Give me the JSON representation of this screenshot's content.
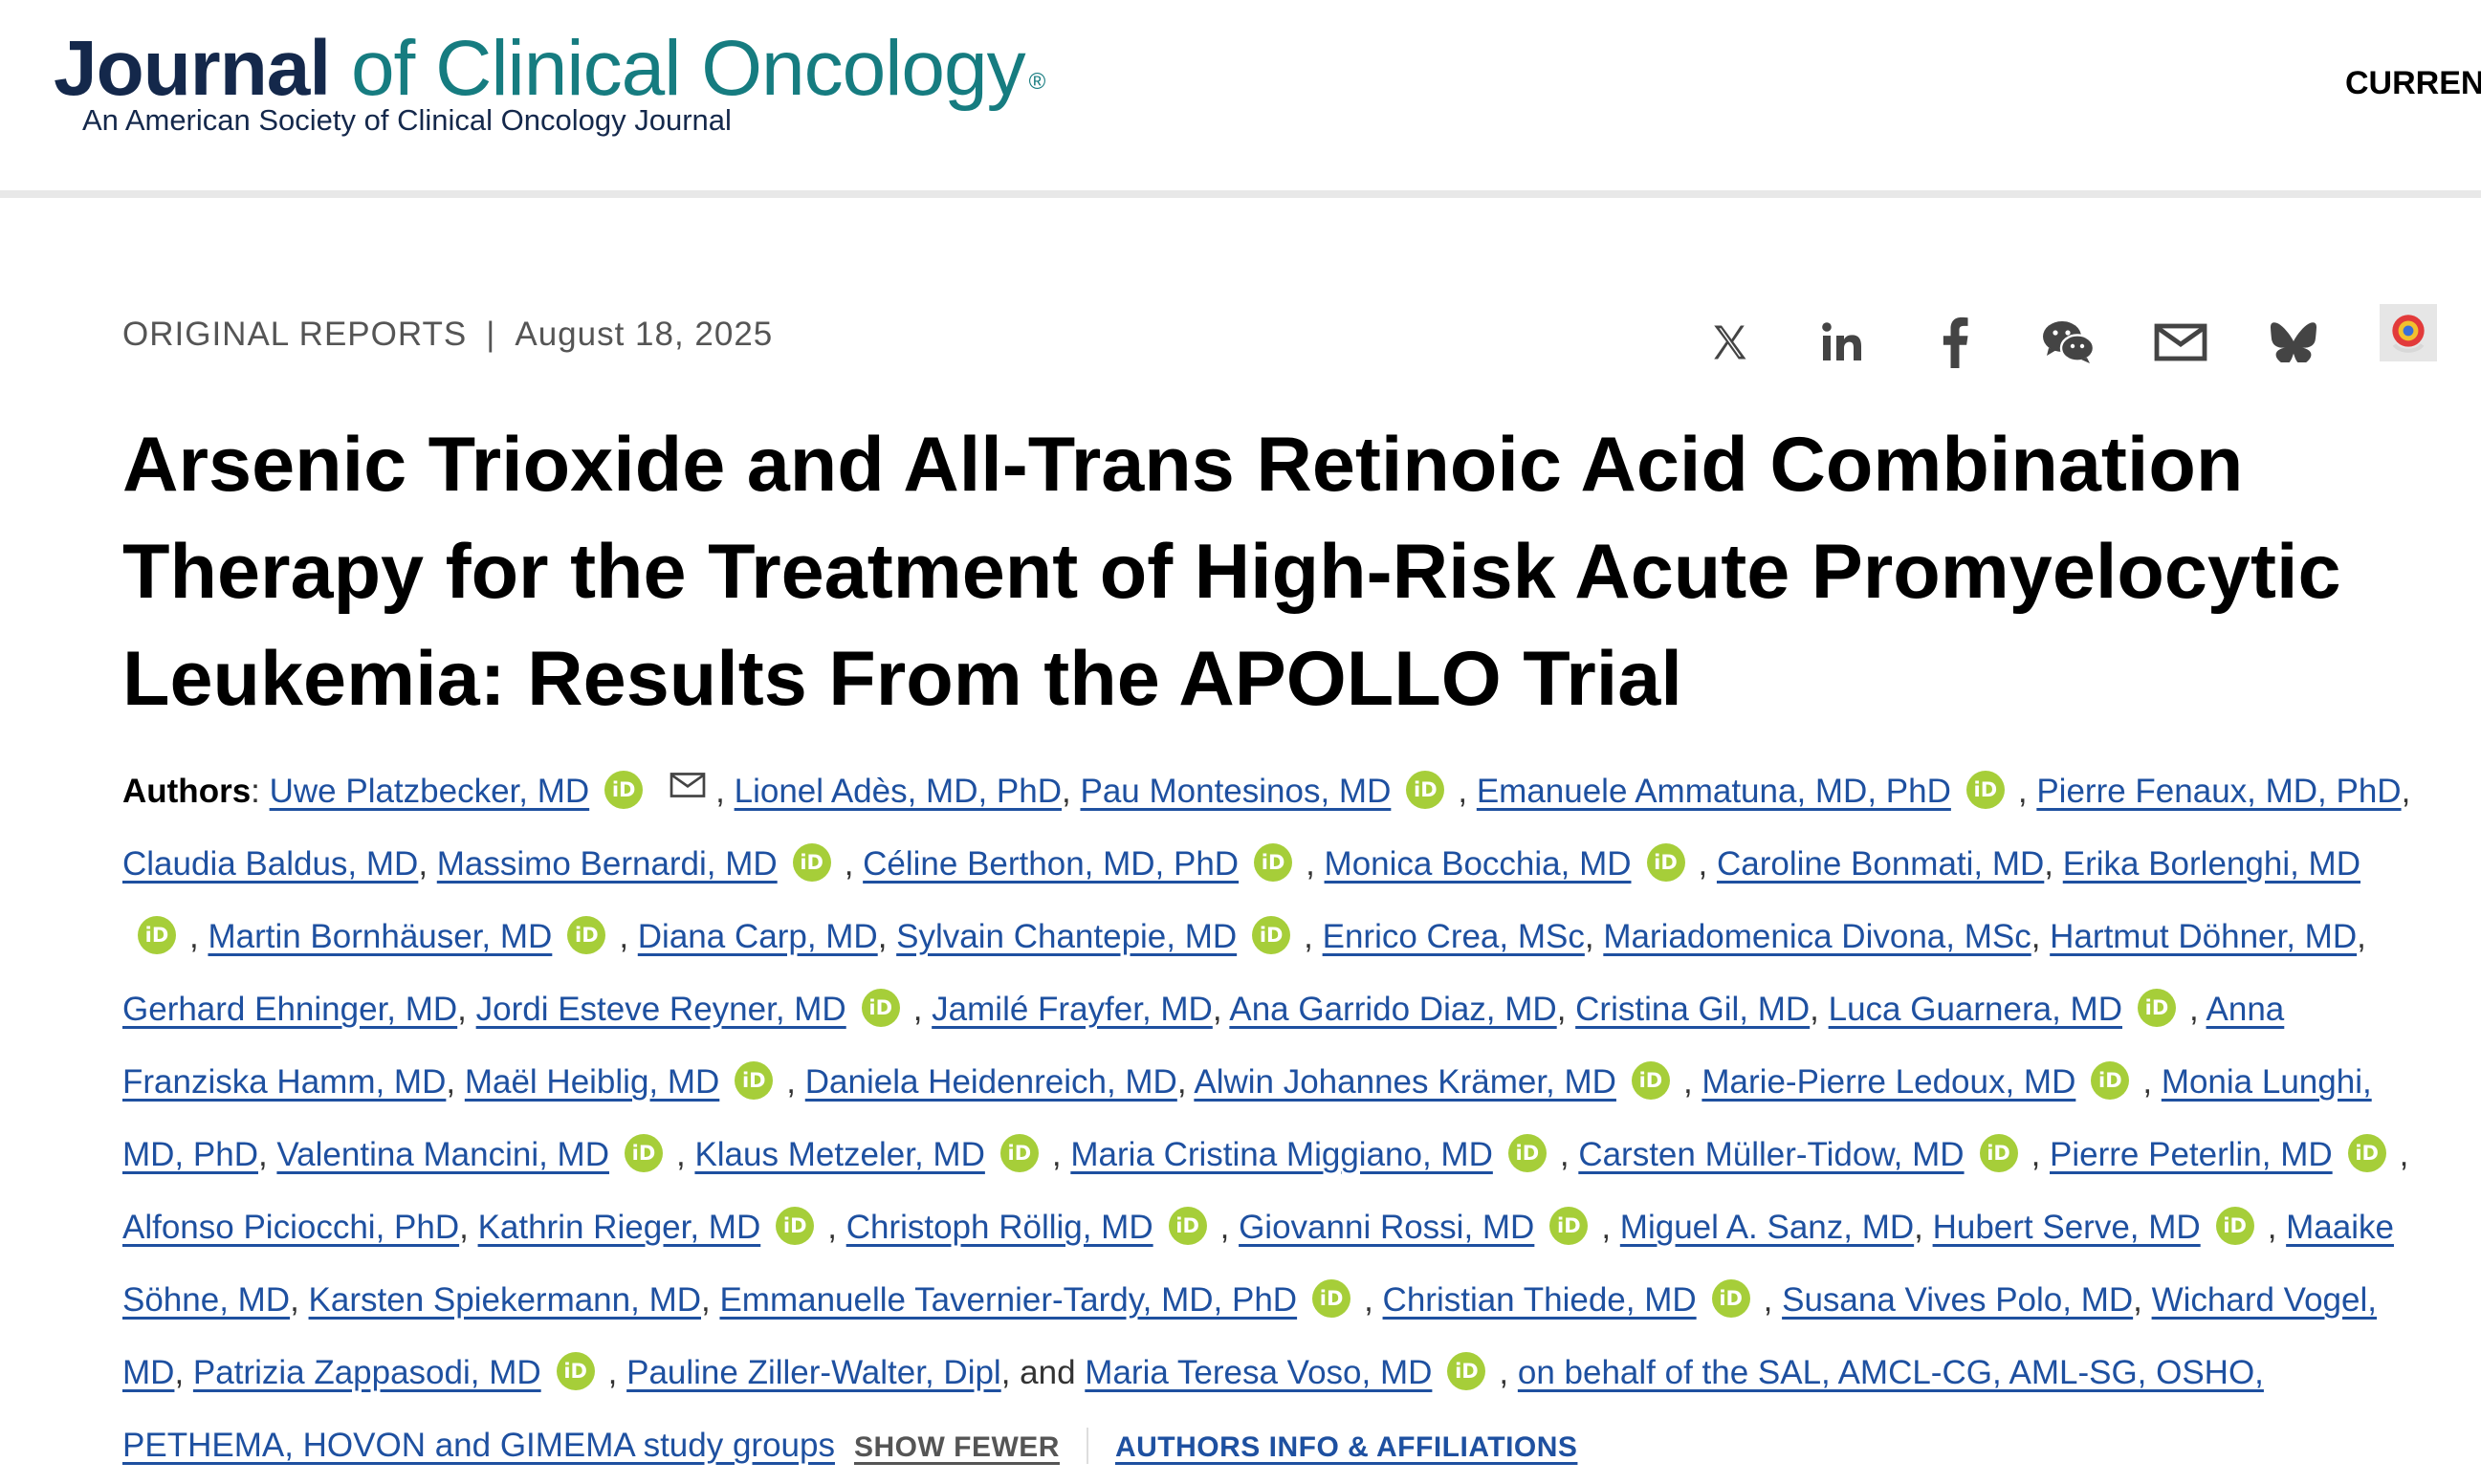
{
  "header": {
    "logo_journal": "Journal",
    "logo_rest": " of Clinical Oncology",
    "logo_reg": "®",
    "logo_sub": "An American Society of Clinical Oncology Journal",
    "nav_current": "CURREN",
    "brand_colors": {
      "navy": "#14284b",
      "teal": "#167c80"
    }
  },
  "article": {
    "section": "ORIGINAL REPORTS",
    "separator": "|",
    "date": "August 18, 2025",
    "title": "Arsenic Trioxide and All-Trans Retinoic Acid Combination Therapy for the Treatment of High-Risk Acute Promyelocytic Leukemia: Results From the APOLLO Trial"
  },
  "share": {
    "icons": [
      "x-icon",
      "linkedin-icon",
      "facebook-icon",
      "wechat-icon",
      "email-icon",
      "bluesky-icon",
      "mendeley-icon"
    ]
  },
  "authors": {
    "label": "Authors",
    "colon": ": ",
    "list": [
      {
        "name": "Uwe Platzbecker, MD",
        "orcid": true,
        "email": true,
        "sep": ", "
      },
      {
        "name": "Lionel Adès, MD, PhD",
        "orcid": false,
        "sep": ", "
      },
      {
        "name": "Pau Montesinos, MD",
        "orcid": true,
        "sep": ", "
      },
      {
        "name": "Emanuele Ammatuna, MD, PhD",
        "orcid": true,
        "sep": ", "
      },
      {
        "name": "Pierre Fenaux, MD, PhD",
        "orcid": false,
        "sep": ", "
      },
      {
        "name": "Claudia Baldus, MD",
        "orcid": false,
        "sep": ", "
      },
      {
        "name": "Massimo Bernardi, MD",
        "orcid": true,
        "sep": ", "
      },
      {
        "name": "Céline Berthon, MD, PhD",
        "orcid": true,
        "sep": ", "
      },
      {
        "name": "Monica Bocchia, MD",
        "orcid": true,
        "sep": ", "
      },
      {
        "name": "Caroline Bonmati, MD",
        "orcid": false,
        "sep": ", "
      },
      {
        "name": "Erika Borlenghi, MD",
        "orcid": true,
        "sep": ", "
      },
      {
        "name": "Martin Bornhäuser, MD",
        "orcid": true,
        "sep": ", "
      },
      {
        "name": "Diana Carp, MD",
        "orcid": false,
        "sep": ", "
      },
      {
        "name": "Sylvain Chantepie, MD",
        "orcid": true,
        "sep": ", "
      },
      {
        "name": "Enrico Crea, MSc",
        "orcid": false,
        "sep": ", "
      },
      {
        "name": "Mariadomenica Divona, MSc",
        "orcid": false,
        "sep": ", "
      },
      {
        "name": "Hartmut Döhner, MD",
        "orcid": false,
        "sep": ", "
      },
      {
        "name": "Gerhard Ehninger, MD",
        "orcid": false,
        "sep": ", "
      },
      {
        "name": "Jordi Esteve Reyner, MD",
        "orcid": true,
        "sep": ", "
      },
      {
        "name": "Jamilé Frayfer, MD",
        "orcid": false,
        "sep": ", "
      },
      {
        "name": "Ana Garrido Diaz, MD",
        "orcid": false,
        "sep": ", "
      },
      {
        "name": "Cristina Gil, MD",
        "orcid": false,
        "sep": ", "
      },
      {
        "name": "Luca Guarnera, MD",
        "orcid": true,
        "sep": ", "
      },
      {
        "name": "Anna Franziska Hamm, MD",
        "orcid": false,
        "sep": ", "
      },
      {
        "name": "Maël Heiblig, MD",
        "orcid": true,
        "sep": ", "
      },
      {
        "name": "Daniela Heidenreich, MD",
        "orcid": false,
        "sep": ", "
      },
      {
        "name": "Alwin Johannes Krämer, MD",
        "orcid": true,
        "sep": ", "
      },
      {
        "name": "Marie-Pierre Ledoux, MD",
        "orcid": true,
        "sep": ", "
      },
      {
        "name": "Monia Lunghi, MD, PhD",
        "orcid": false,
        "sep": ", "
      },
      {
        "name": "Valentina Mancini, MD",
        "orcid": true,
        "sep": ", "
      },
      {
        "name": "Klaus Metzeler, MD",
        "orcid": true,
        "sep": ", "
      },
      {
        "name": "Maria Cristina Miggiano, MD",
        "orcid": true,
        "sep": ", "
      },
      {
        "name": "Carsten Müller-Tidow, MD",
        "orcid": true,
        "sep": ", "
      },
      {
        "name": "Pierre Peterlin, MD",
        "orcid": true,
        "sep": ", "
      },
      {
        "name": "Alfonso Piciocchi, PhD",
        "orcid": false,
        "sep": ", "
      },
      {
        "name": "Kathrin Rieger, MD",
        "orcid": true,
        "sep": ", "
      },
      {
        "name": "Christoph Röllig, MD",
        "orcid": true,
        "sep": ", "
      },
      {
        "name": "Giovanni Rossi, MD",
        "orcid": true,
        "sep": ", "
      },
      {
        "name": "Miguel A. Sanz, MD",
        "orcid": false,
        "sep": ", "
      },
      {
        "name": "Hubert Serve, MD",
        "orcid": true,
        "sep": ", "
      },
      {
        "name": "Maaike Söhne, MD",
        "orcid": false,
        "sep": ", "
      },
      {
        "name": "Karsten Spiekermann, MD",
        "orcid": false,
        "sep": ", "
      },
      {
        "name": "Emmanuelle Tavernier-Tardy, MD, PhD",
        "orcid": true,
        "sep": ", "
      },
      {
        "name": "Christian Thiede, MD",
        "orcid": true,
        "sep": ", "
      },
      {
        "name": "Susana Vives Polo, MD",
        "orcid": false,
        "sep": ", "
      },
      {
        "name": "Wichard Vogel, MD",
        "orcid": false,
        "sep": ", "
      },
      {
        "name": "Patrizia Zappasodi, MD",
        "orcid": true,
        "sep": ", "
      },
      {
        "name": "Pauline Ziller-Walter, Dipl",
        "orcid": false,
        "sep": ", and "
      },
      {
        "name": "Maria Teresa Voso, MD",
        "orcid": true,
        "sep": ", "
      },
      {
        "name": "on behalf of the SAL, AMCL-CG, AML-SG, OSHO, PETHEMA, HOVON and GIMEMA study groups",
        "orcid": false,
        "sep": ""
      }
    ],
    "orcid_text": "iD",
    "orcid_color": "#a6ce39",
    "link_color": "#1e50a0",
    "show_fewer": "SHOW FEWER",
    "affiliations_link": "AUTHORS INFO & AFFILIATIONS"
  }
}
